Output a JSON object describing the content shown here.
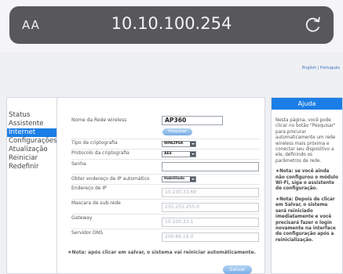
{
  "browser": {
    "text_size_label": "AA",
    "url": "10.10.100.254",
    "reload_icon": "reload-icon"
  },
  "language_links": "English | Português",
  "sidebar": {
    "items": [
      {
        "label": "Status",
        "active": false
      },
      {
        "label": "Assistente",
        "active": false
      },
      {
        "label": "Internet",
        "active": true
      },
      {
        "label": "Configurações",
        "active": false
      },
      {
        "label": "Atualização",
        "active": false
      },
      {
        "label": "Reiniciar",
        "active": false
      },
      {
        "label": "Redefinir",
        "active": false
      }
    ]
  },
  "form": {
    "ssid_label": "Nome da Rede wireless",
    "ssid_value": "AP360",
    "search_button": "Pesquisar",
    "encryption_label": "Tipo de criptografia",
    "encryption_value": "WPA2PSK",
    "protocol_label": "Protocolo da criptografia",
    "protocol_value": "AES",
    "password_label": "Senha",
    "password_value": "",
    "auto_ip_label": "Obter endereço de IP automático",
    "auto_ip_value": "Habilitado",
    "ip_label": "Endereço de IP",
    "ip_value": "10.100.33.69",
    "mask_label": "Mascara de sub-rede",
    "mask_value": "255.255.255.0",
    "gateway_label": "Gateway",
    "gateway_value": "10.100.33.1",
    "dns_label": "Servidor DNS",
    "dns_value": "200.86.16.0",
    "note": "★Nota: após clicar em salvar, o sistema vai reiniciar automáticamente.",
    "save_button": "Salvar"
  },
  "help": {
    "title": "Ajuda",
    "p1": "Nesta página, você pode clicar no botão \"Pesquisar\" para procurar automaticamente um rede wireless mais próxima e conectar seu dispositivo a ele, definindo os parâmetros de rede.",
    "p2": "★Nota: se você ainda não configurou o módulo Wi-Fi, siga o assistente de configuração.",
    "p3": "★Nota: Depois de clicar em Salvar, o sistema será reiniciado imediatamente e você precisará fazer o login novamente na interface de configuração após a reinicialização."
  }
}
